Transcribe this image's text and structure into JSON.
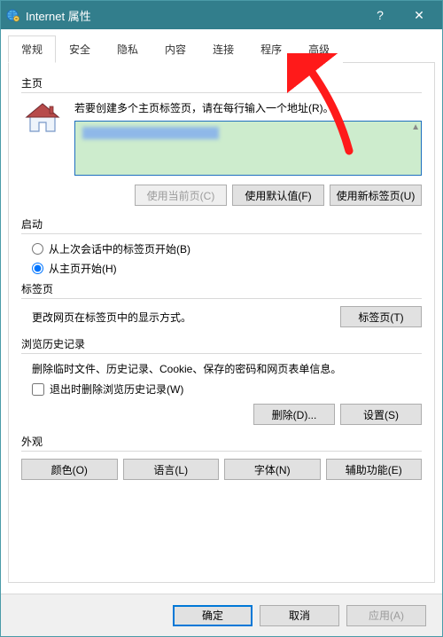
{
  "titlebar": {
    "title": "Internet 属性",
    "help": "?",
    "close": "✕"
  },
  "tabs": {
    "general": "常规",
    "security": "安全",
    "privacy": "隐私",
    "content": "内容",
    "connections": "连接",
    "programs": "程序",
    "advanced": "高级"
  },
  "home": {
    "section": "主页",
    "instruction": "若要创建多个主页标签页，请在每行输入一个地址(R)。",
    "url_hidden": "https://www.baidu.com",
    "use_current": "使用当前页(C)",
    "use_default": "使用默认值(F)",
    "use_newtab": "使用新标签页(U)"
  },
  "startup": {
    "section": "启动",
    "from_last": "从上次会话中的标签页开始(B)",
    "from_home": "从主页开始(H)"
  },
  "tabsection": {
    "section": "标签页",
    "desc": "更改网页在标签页中的显示方式。",
    "button": "标签页(T)"
  },
  "history": {
    "section": "浏览历史记录",
    "desc": "删除临时文件、历史记录、Cookie、保存的密码和网页表单信息。",
    "delete_on_exit": "退出时删除浏览历史记录(W)",
    "delete": "删除(D)...",
    "settings": "设置(S)"
  },
  "appearance": {
    "section": "外观",
    "colors": "颜色(O)",
    "languages": "语言(L)",
    "fonts": "字体(N)",
    "accessibility": "辅助功能(E)"
  },
  "footer": {
    "ok": "确定",
    "cancel": "取消",
    "apply": "应用(A)"
  }
}
